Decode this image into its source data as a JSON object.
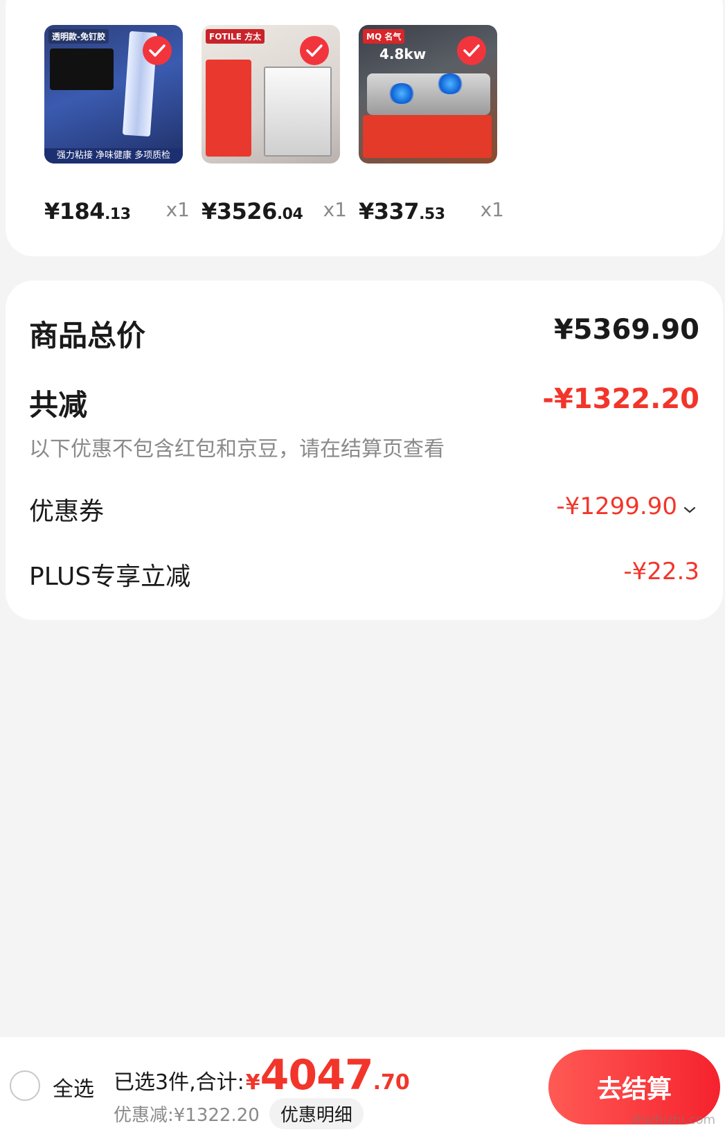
{
  "products": [
    {
      "thumb_tag": "透明款-免钉胶",
      "thumb_footer": "强力粘接 净味健康 多项质检",
      "price_int": "¥184",
      "price_dec": ".13",
      "qty": "x1"
    },
    {
      "thumb_tag": "FOTILE 方太",
      "thumb_footer": "",
      "price_int": "¥3526",
      "price_dec": ".04",
      "qty": "x1"
    },
    {
      "thumb_tag": "MQ 名气",
      "thumb_footer": "",
      "thumb_big": "4.8kw",
      "price_int": "¥337",
      "price_dec": ".53",
      "qty": "x1"
    }
  ],
  "summary": {
    "total_label": "商品总价",
    "total_value": "¥5369.90",
    "reduce_label": "共减",
    "reduce_value": "-¥1322.20",
    "note": "以下优惠不包含红包和京豆，请在结算页查看",
    "coupon_label": "优惠券",
    "coupon_value": "-¥1299.90",
    "plus_label": "PLUS专享立减",
    "plus_value": "-¥22.3"
  },
  "bottom": {
    "select_all": "全选",
    "selected_text": "已选3件,合计:",
    "total_yen": "¥",
    "total_int": "4047",
    "total_dec": ".70",
    "discount_text": "优惠减:¥1322.20",
    "detail_label": "优惠明细",
    "checkout_label": "去结算"
  },
  "watermark": "zhizhizhi.com",
  "colors": {
    "accent_red": "#f2352a",
    "check_badge": "#f2353c"
  }
}
